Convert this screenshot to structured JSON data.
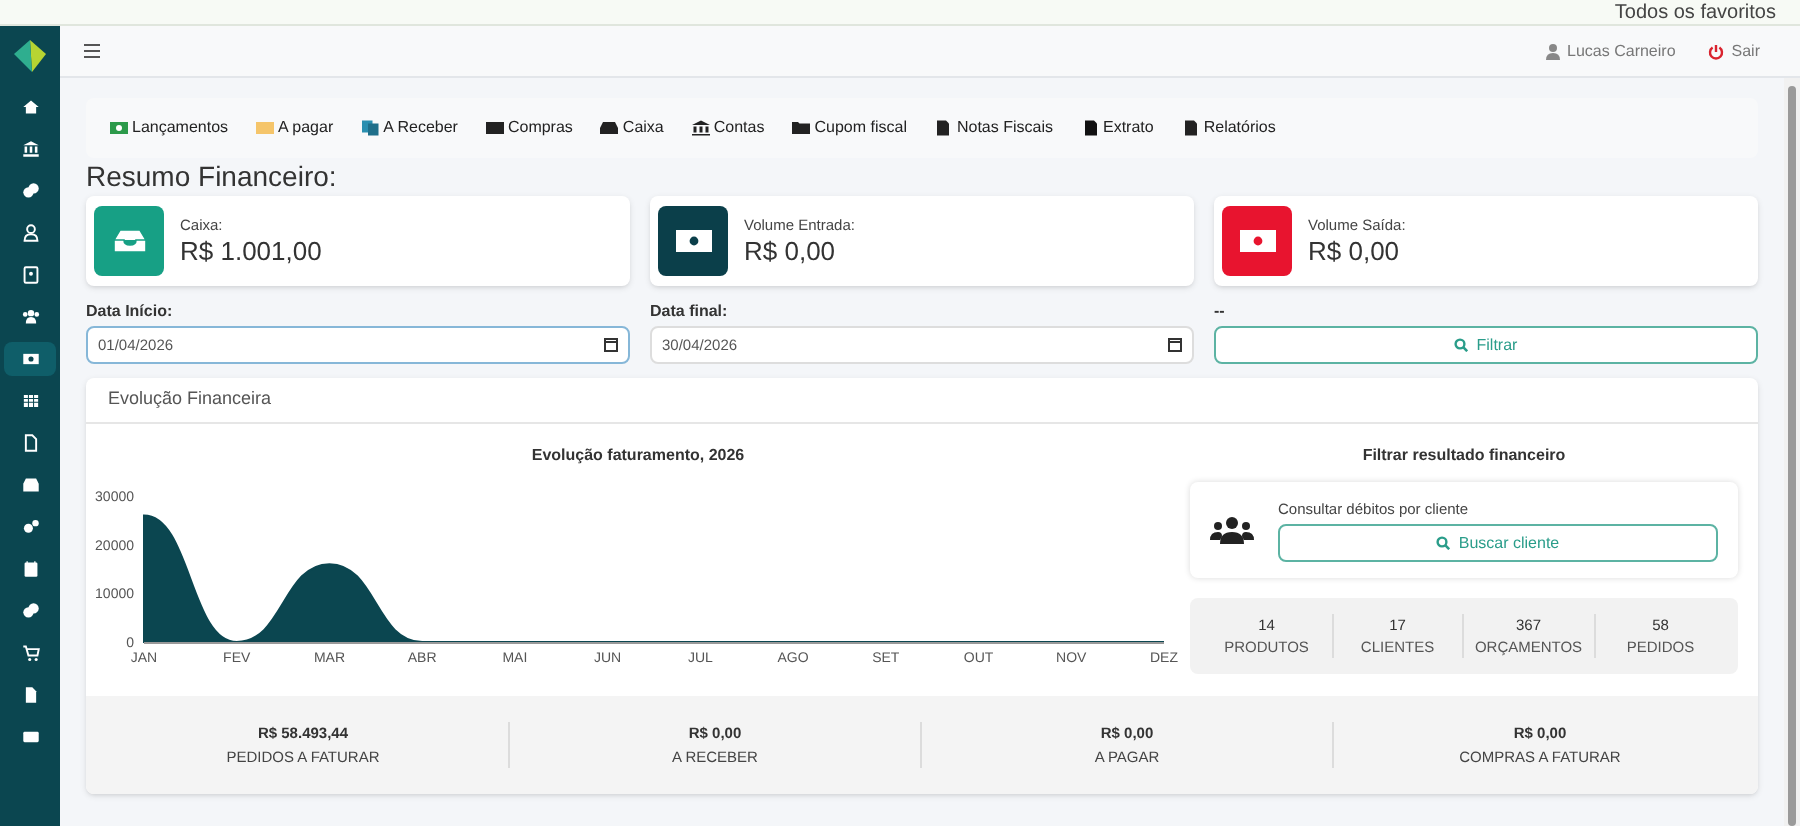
{
  "bookmarks_bar": {
    "label": "Todos os favoritos"
  },
  "sidebar": {
    "items": [
      {
        "selected": false
      },
      {
        "selected": false
      },
      {
        "selected": false
      },
      {
        "selected": false
      },
      {
        "selected": false
      },
      {
        "selected": false
      },
      {
        "selected": true
      },
      {
        "selected": false
      },
      {
        "selected": false
      },
      {
        "selected": false
      },
      {
        "selected": false
      },
      {
        "selected": false
      },
      {
        "selected": false
      },
      {
        "selected": false
      },
      {
        "selected": false
      },
      {
        "selected": false
      }
    ]
  },
  "header": {
    "user": "Lucas Carneiro",
    "logout": "Sair"
  },
  "nav": [
    "Lançamentos",
    "A pagar",
    "A Receber",
    "Compras",
    "Caixa",
    "Contas",
    "Cupom fiscal",
    "Notas Fiscais",
    "Extrato",
    "Relatórios"
  ],
  "title": "Resumo Financeiro:",
  "summary_cards": [
    {
      "label": "Caixa:",
      "value": "R$ 1.001,00",
      "color": "#17a085",
      "kind": "inbox"
    },
    {
      "label": "Volume Entrada:",
      "value": "R$ 0,00",
      "color": "#0b3f4a",
      "kind": "money"
    },
    {
      "label": "Volume Saída:",
      "value": "R$ 0,00",
      "color": "#e8142f",
      "kind": "money"
    }
  ],
  "filters": {
    "start_label": "Data Início:",
    "start_value": "01/04/2026",
    "end_label": "Data final:",
    "end_value": "30/04/2026",
    "button_label": "--",
    "button": "Filtrar"
  },
  "panel": {
    "title": "Evolução Financeira",
    "chart_data": {
      "type": "area",
      "title": "Evolução faturamento, 2026",
      "categories": [
        "JAN",
        "FEV",
        "MAR",
        "ABR",
        "MAI",
        "JUN",
        "JUL",
        "AGO",
        "SET",
        "OUT",
        "NOV",
        "DEZ"
      ],
      "series": [
        {
          "color": "#0b4650",
          "values": [
            26000,
            0,
            16000,
            0,
            0,
            0,
            0,
            0,
            0,
            0,
            0,
            0
          ]
        }
      ],
      "ylim": [
        0,
        30000
      ],
      "yticks": [
        0,
        10000,
        20000,
        30000
      ]
    },
    "side_title": "Filtrar resultado financeiro",
    "client_search": {
      "label": "Consultar débitos por cliente",
      "button": "Buscar cliente"
    },
    "counts": [
      {
        "value": "14",
        "label": "PRODUTOS"
      },
      {
        "value": "17",
        "label": "CLIENTES"
      },
      {
        "value": "367",
        "label": "ORÇAMENTOS"
      },
      {
        "value": "58",
        "label": "PEDIDOS"
      }
    ],
    "totals": [
      {
        "value": "R$ 58.493,44",
        "label": "PEDIDOS A FATURAR"
      },
      {
        "value": "R$ 0,00",
        "label": "A RECEBER"
      },
      {
        "value": "R$ 0,00",
        "label": "A PAGAR"
      },
      {
        "value": "R$ 0,00",
        "label": "COMPRAS A FATURAR"
      }
    ]
  }
}
